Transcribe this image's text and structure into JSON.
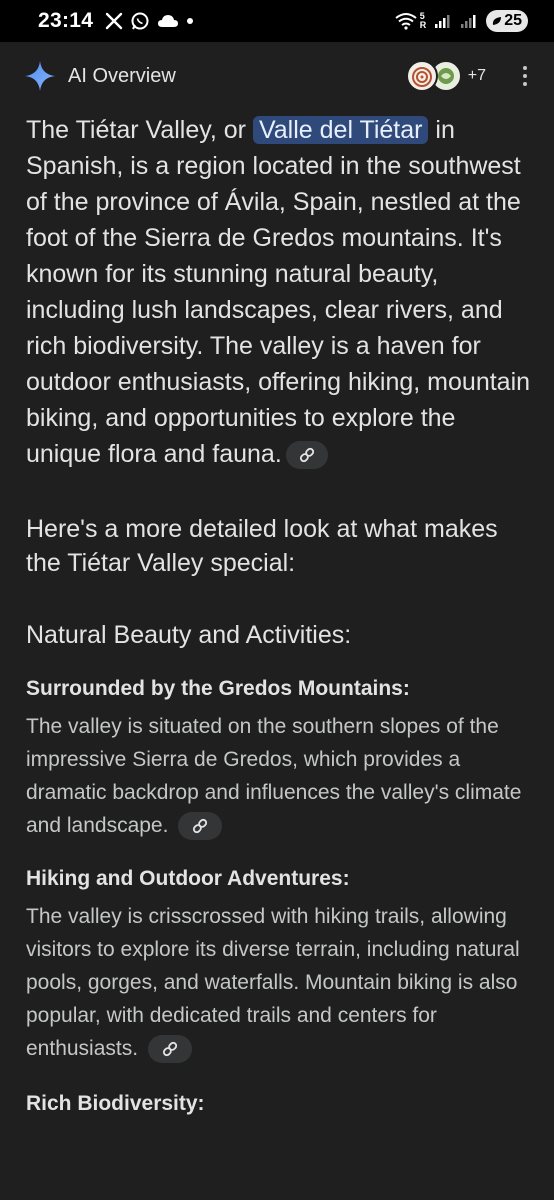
{
  "status_bar": {
    "time": "23:14",
    "battery": "25",
    "signal_badge_top": "5",
    "signal_badge_bottom": "R"
  },
  "header": {
    "title": "AI Overview",
    "source_count": "+7"
  },
  "overview": {
    "intro_before": "The Tiétar Valley, or ",
    "intro_highlight": "Valle del Tiétar",
    "intro_after": " in Spanish, is a region located in the southwest of the province of Ávila, Spain, nestled at the foot of the Sierra de Gredos mountains. It's known for its stunning natural beauty, including lush landscapes, clear rivers, and rich biodiversity. The valley is a haven for outdoor enthusiasts, offering hiking, mountain biking, and opportunities to explore the unique flora and fauna.",
    "lead": "Here's a more detailed look at what makes the Tiétar Valley special:",
    "section_heading": "Natural Beauty and Activities:",
    "items": [
      {
        "title": "Surrounded by the Gredos Mountains:",
        "body": "The valley is situated on the southern slopes of the impressive Sierra de Gredos, which provides a dramatic backdrop and influences the valley's climate and landscape."
      },
      {
        "title": "Hiking and Outdoor Adventures:",
        "body": "The valley is crisscrossed with hiking trails, allowing visitors to explore its diverse terrain, including natural pools, gorges, and waterfalls. Mountain biking is also popular, with dedicated trails and centers for enthusiasts."
      }
    ],
    "next_title": "Rich Biodiversity:"
  },
  "colors": {
    "background": "#1f1f1f",
    "highlight": "#2f4a7a",
    "text_primary": "#e3e3e3",
    "text_secondary": "#c4c7c5"
  },
  "icons": {
    "header": "gemini-sparkle-icon",
    "link": "link-icon",
    "more": "more-vert-icon"
  }
}
